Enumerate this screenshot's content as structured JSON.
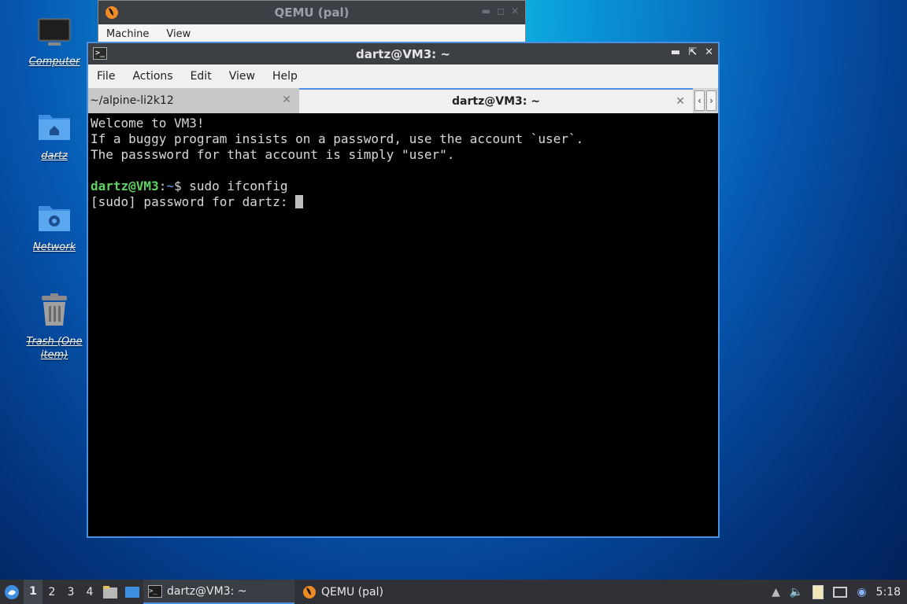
{
  "desktop": {
    "icons": [
      {
        "label": "Computer"
      },
      {
        "label": "dartz"
      },
      {
        "label": "Network"
      },
      {
        "label": "Trash (One item)"
      }
    ]
  },
  "qemu_window": {
    "title": "QEMU (pal)",
    "menu": [
      "Machine",
      "View"
    ]
  },
  "terminal_window": {
    "title": "dartz@VM3: ~",
    "menu": [
      "File",
      "Actions",
      "Edit",
      "View",
      "Help"
    ],
    "tabs": [
      {
        "label": "~/alpine-li2k12",
        "active": false
      },
      {
        "label": "dartz@VM3: ~",
        "active": true
      }
    ],
    "output": {
      "line1": "Welcome to VM3!",
      "line2": "If a buggy program insists on a password, use the account `user`.",
      "line3": "The passsword for that account is simply \"user\".",
      "prompt_user": "dartz@VM3",
      "prompt_sep": ":",
      "prompt_path": "~",
      "prompt_symbol": "$ ",
      "command": "sudo ifconfig",
      "sudo_prompt": "[sudo] password for dartz: "
    }
  },
  "taskbar": {
    "workspaces": [
      "1",
      "2",
      "3",
      "4"
    ],
    "tasks": [
      {
        "label": "dartz@VM3: ~",
        "active": true
      },
      {
        "label": "QEMU (pal)",
        "active": false
      }
    ],
    "clock": "5:18"
  },
  "colors": {
    "accent": "#4a8fe0",
    "prompt_user": "#5fd35f",
    "prompt_path": "#6fa0ff",
    "terminal_bg": "#000000"
  }
}
